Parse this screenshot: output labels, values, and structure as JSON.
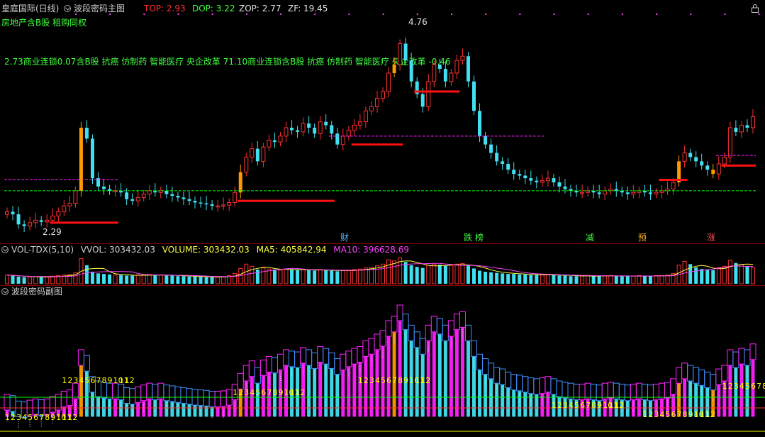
{
  "header": {
    "stock": "皇庭国际(日线)",
    "indicator": "波段密码主图",
    "top_label": "TOP: 2.93",
    "dop_label": "DOP: 3.22",
    "zop_label": "ZOP: 2.77",
    "zf_label": "ZF: 19.45",
    "concepts": "房地产含B股 租购同权",
    "ticker_line": "2.73商业连锁0.07含B股 抗癌 仿制药 智能医疗 央企改革 71.10商业连锁含B股 抗癌 仿制药 智能医疗 央企改革 -0.46"
  },
  "annotations": {
    "high": "4.76",
    "low": "2.29"
  },
  "event_tags": [
    {
      "text": "财",
      "color": "#5fb4ff"
    },
    {
      "text": "跌",
      "color": "#3fff3f"
    },
    {
      "text": "榜",
      "color": "#3fff3f"
    },
    {
      "text": "减",
      "color": "#3fff3f"
    },
    {
      "text": "预",
      "color": "#ffb020"
    },
    {
      "text": "涨",
      "color": "#ff5050"
    }
  ],
  "volume_panel": {
    "name": "VOL-TDX(5,10)",
    "vvol": "VVOL: 303432.03",
    "volume": "VOLUME: 303432.03",
    "ma5": "MA5: 405842.94",
    "ma10": "MA10: 396628.69"
  },
  "sub_panel": {
    "name": "波段密码副图"
  },
  "colors": {
    "up": "#ff3030",
    "down": "#40e0f0",
    "signal": "#ff9a00",
    "magenta": "#ff20ff",
    "cyan": "#40e0f0",
    "green": "#00ff00",
    "yellow": "#ffff00",
    "red_line": "#ff1010"
  },
  "chart_data": [
    {
      "type": "candlestick",
      "title": "波段密码主图",
      "closes": [
        2.55,
        2.52,
        2.4,
        2.38,
        2.42,
        2.45,
        2.43,
        2.45,
        2.5,
        2.55,
        2.62,
        2.65,
        2.8,
        3.55,
        3.42,
        2.95,
        2.85,
        2.82,
        2.8,
        2.8,
        2.78,
        2.7,
        2.68,
        2.72,
        2.76,
        2.8,
        2.78,
        2.8,
        2.76,
        2.74,
        2.72,
        2.7,
        2.68,
        2.66,
        2.65,
        2.64,
        2.62,
        2.62,
        2.63,
        2.66,
        2.78,
        3.02,
        3.2,
        3.3,
        3.15,
        3.32,
        3.4,
        3.38,
        3.45,
        3.55,
        3.52,
        3.5,
        3.6,
        3.55,
        3.48,
        3.62,
        3.58,
        3.48,
        3.35,
        3.45,
        3.52,
        3.58,
        3.62,
        3.75,
        3.8,
        3.9,
        3.98,
        4.2,
        4.3,
        4.55,
        4.35,
        4.1,
        3.95,
        3.8,
        4.1,
        4.3,
        4.25,
        4.1,
        4.2,
        4.35,
        4.4,
        4.1,
        3.75,
        3.45,
        3.35,
        3.25,
        3.15,
        3.12,
        3.05,
        3.0,
        2.98,
        2.95,
        2.92,
        2.9,
        2.92,
        2.95,
        2.9,
        2.85,
        2.82,
        2.8,
        2.78,
        2.78,
        2.8,
        2.78,
        2.76,
        2.8,
        2.82,
        2.8,
        2.78,
        2.76,
        2.78,
        2.8,
        2.78,
        2.76,
        2.78,
        2.8,
        2.82,
        2.9,
        3.15,
        3.25,
        3.2,
        3.15,
        3.1,
        3.05,
        3.0,
        3.12,
        3.2,
        3.55,
        3.5,
        3.58,
        3.55,
        3.68
      ],
      "high_marker": 4.76,
      "low_marker": 2.29,
      "ylim": [
        2.2,
        4.9
      ],
      "series": [
        {
          "name": "TOP",
          "value": 2.93
        },
        {
          "name": "DOP",
          "value": 3.22
        },
        {
          "name": "ZOP",
          "value": 2.77
        },
        {
          "name": "ZF",
          "value": 19.45
        }
      ]
    },
    {
      "type": "bar",
      "title": "VOL-TDX(5,10)",
      "volume": 303432.03,
      "ma5": 405842.94,
      "ma10": 396628.69,
      "values": [
        1.6,
        1.5,
        1.3,
        1.2,
        1.2,
        1.3,
        1.2,
        1.3,
        1.4,
        1.5,
        1.6,
        1.7,
        2.0,
        4.6,
        3.4,
        2.2,
        1.9,
        1.8,
        1.7,
        1.6,
        1.6,
        1.5,
        1.5,
        1.6,
        1.6,
        1.7,
        1.6,
        1.6,
        1.5,
        1.5,
        1.4,
        1.4,
        1.3,
        1.3,
        1.3,
        1.2,
        1.2,
        1.2,
        1.3,
        1.5,
        1.9,
        2.8,
        3.6,
        3.2,
        2.6,
        2.9,
        2.7,
        2.6,
        2.5,
        2.7,
        2.6,
        2.5,
        2.6,
        2.5,
        2.4,
        2.6,
        2.5,
        2.4,
        2.3,
        2.4,
        2.5,
        2.6,
        2.7,
        2.9,
        3.0,
        3.3,
        3.6,
        4.4,
        4.2,
        4.8,
        4.0,
        3.4,
        3.1,
        2.9,
        3.4,
        3.6,
        3.5,
        3.3,
        3.4,
        3.6,
        3.7,
        3.3,
        2.8,
        2.4,
        2.2,
        2.1,
        2.0,
        1.9,
        1.8,
        1.8,
        1.7,
        1.7,
        1.6,
        1.6,
        1.6,
        1.7,
        1.6,
        1.5,
        1.5,
        1.4,
        1.4,
        1.4,
        1.5,
        1.4,
        1.4,
        1.5,
        1.5,
        1.4,
        1.4,
        1.4,
        1.4,
        1.5,
        1.4,
        1.4,
        1.5,
        1.5,
        1.6,
        1.9,
        3.4,
        4.1,
        3.6,
        3.0,
        2.7,
        2.6,
        2.5,
        3.0,
        3.2,
        4.3,
        3.8,
        3.5,
        3.2,
        3.0
      ]
    },
    {
      "type": "bar",
      "title": "波段密码副图",
      "counters": [
        "1",
        "2",
        "3",
        "4",
        "5",
        "6",
        "7",
        "8",
        "9",
        "10",
        "11",
        "12"
      ]
    }
  ]
}
